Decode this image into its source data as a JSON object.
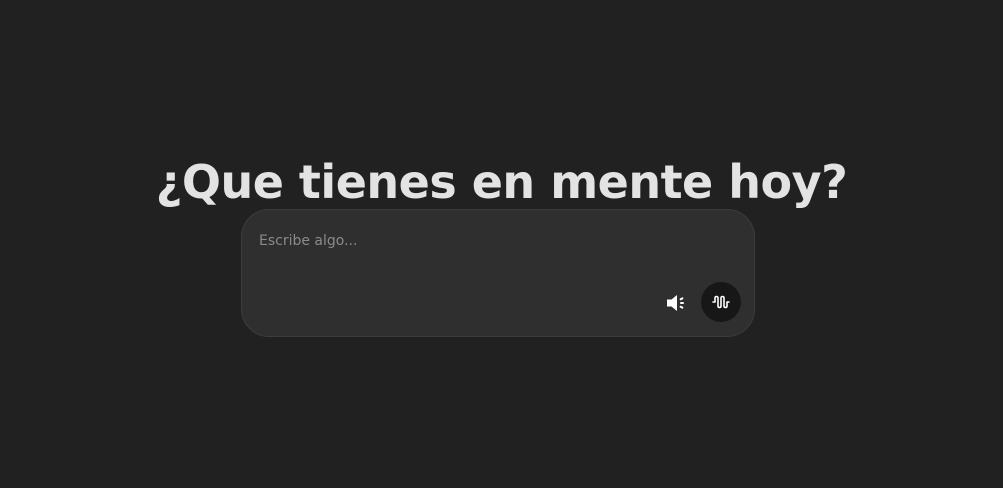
{
  "headline": "¿Que tienes en mente hoy?",
  "composer": {
    "placeholder": "Escribe algo...",
    "value": ""
  },
  "icons": {
    "speaker": "speaker-volume-icon",
    "voice": "sound-wave-icon"
  },
  "colors": {
    "background": "#212121",
    "composer_background": "#2f2f2f",
    "headline_text": "#e3e3e3",
    "placeholder_text": "#8a8a8a",
    "voice_button_background": "#171717"
  }
}
